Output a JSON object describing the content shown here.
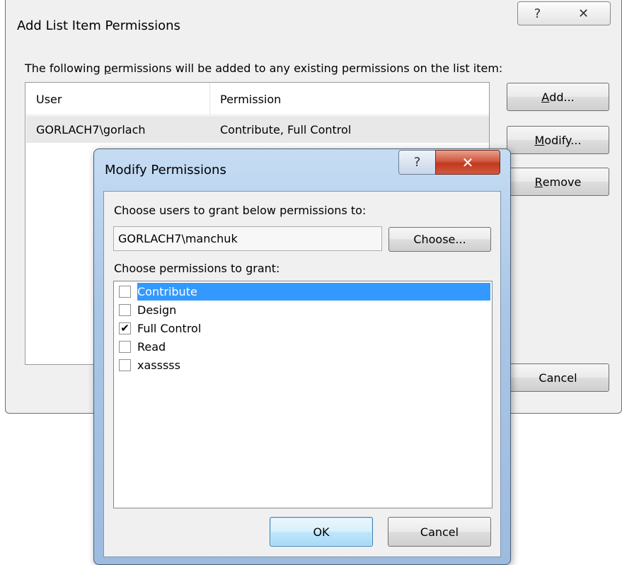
{
  "outer_dialog": {
    "title": "Add List Item Permissions",
    "help_icon": "?",
    "close_icon": "✕",
    "caption_pre": "The following ",
    "caption_accel": "p",
    "caption_post": "ermissions will be added to any existing permissions on the list item:",
    "columns": [
      "User",
      "Permission"
    ],
    "rows": [
      {
        "user": "GORLACH7\\gorlach",
        "permission": "Contribute, Full Control"
      }
    ],
    "buttons": {
      "add_accel": "A",
      "add_rest": "dd...",
      "modify_accel": "M",
      "modify_rest": "odify...",
      "remove_accel": "R",
      "remove_rest": "emove",
      "cancel": "Cancel"
    }
  },
  "modify_dialog": {
    "title": "Modify Permissions",
    "help_icon": "?",
    "close_icon": "✕",
    "users_label": "Choose users to grant below permissions to:",
    "user_value": "GORLACH7\\manchuk",
    "choose_button": "Choose...",
    "perms_label": "Choose permissions to grant:",
    "permissions": [
      {
        "label": "Contribute",
        "checked": false,
        "selected": true
      },
      {
        "label": "Design",
        "checked": false,
        "selected": false
      },
      {
        "label": "Full Control",
        "checked": true,
        "selected": false
      },
      {
        "label": "Read",
        "checked": false,
        "selected": false
      },
      {
        "label": "xasssss",
        "checked": false,
        "selected": false
      }
    ],
    "check_mark": "✔",
    "ok_button": "OK",
    "cancel_button": "Cancel"
  }
}
